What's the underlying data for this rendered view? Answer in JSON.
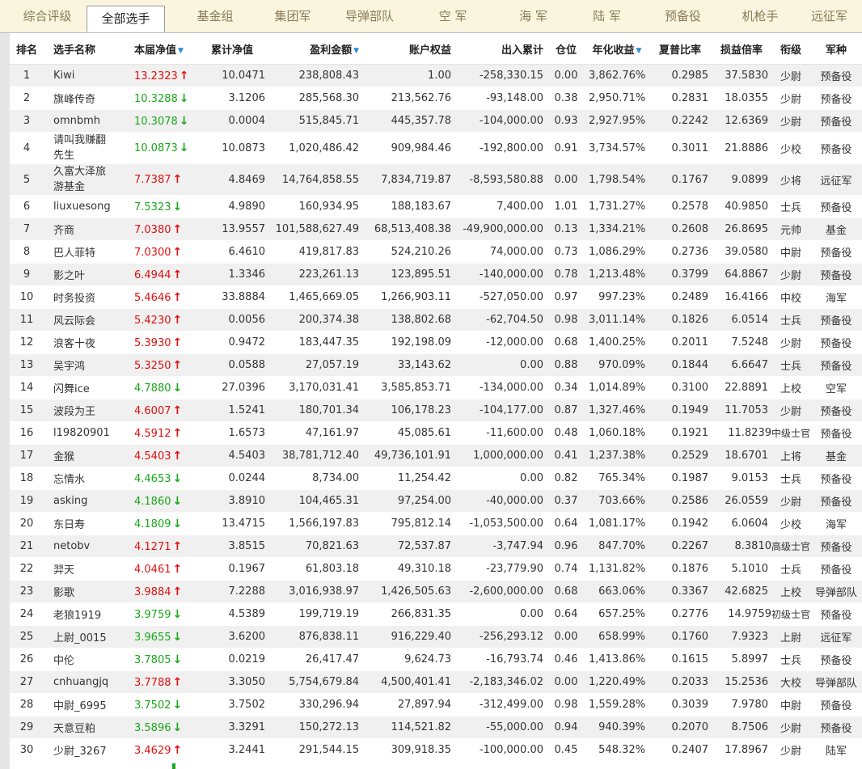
{
  "tabs": [
    "综合评级",
    "全部选手",
    "基金组",
    "集团军",
    "导弹部队",
    "空 军",
    "海 军",
    "陆 军",
    "预备役",
    "机枪手",
    "远征军"
  ],
  "active_tab": "全部选手",
  "columns": [
    "排名",
    "选手名称",
    "本届净值",
    "累计净值",
    "盈利金额",
    "账户权益",
    "出入累计",
    "仓位",
    "年化收益",
    "夏普比率",
    "损益倍率",
    "衔级",
    "军种"
  ],
  "sortable_icon": "sort-down-icon",
  "colors": {
    "up": "#e01010",
    "down": "#1aa81a",
    "accent": "#2a8fd0"
  },
  "rows": [
    {
      "rank": "1",
      "name": "Kiwi",
      "nv": "13.2323",
      "dir": "up",
      "cum": "10.0471",
      "profit": "238,808.43",
      "equity": "1.00",
      "flow": "-258,330.15",
      "pos": "0.00",
      "annual": "3,862.76%",
      "sharpe": "0.2985",
      "pl": "37.5830",
      "rankTitle": "少尉",
      "branch": "预备役"
    },
    {
      "rank": "2",
      "name": "旗峰传奇",
      "nv": "10.3288",
      "dir": "down",
      "cum": "3.1206",
      "profit": "285,568.30",
      "equity": "213,562.76",
      "flow": "-93,148.00",
      "pos": "0.38",
      "annual": "2,950.71%",
      "sharpe": "0.2831",
      "pl": "18.0355",
      "rankTitle": "少尉",
      "branch": "预备役"
    },
    {
      "rank": "3",
      "name": "omnbmh",
      "nv": "10.3078",
      "dir": "down",
      "cum": "0.0004",
      "profit": "515,845.71",
      "equity": "445,357.78",
      "flow": "-104,000.00",
      "pos": "0.93",
      "annual": "2,927.95%",
      "sharpe": "0.2242",
      "pl": "12.6369",
      "rankTitle": "少尉",
      "branch": "预备役"
    },
    {
      "rank": "4",
      "name": "请叫我赚翻先生",
      "nv": "10.0873",
      "dir": "down",
      "cum": "10.0873",
      "profit": "1,020,486.42",
      "equity": "909,984.46",
      "flow": "-192,800.00",
      "pos": "0.91",
      "annual": "3,734.57%",
      "sharpe": "0.3011",
      "pl": "21.8886",
      "rankTitle": "少校",
      "branch": "预备役",
      "tall": true
    },
    {
      "rank": "5",
      "name": "久富大泽旅游基金",
      "nv": "7.7387",
      "dir": "up",
      "cum": "4.8469",
      "profit": "14,764,858.55",
      "equity": "7,834,719.87",
      "flow": "-8,593,580.88",
      "pos": "0.00",
      "annual": "1,798.54%",
      "sharpe": "0.1767",
      "pl": "9.0899",
      "rankTitle": "少将",
      "branch": "远征军",
      "tall": true
    },
    {
      "rank": "6",
      "name": "liuxuesong",
      "nv": "7.5323",
      "dir": "down",
      "cum": "4.9890",
      "profit": "160,934.95",
      "equity": "188,183.67",
      "flow": "7,400.00",
      "pos": "1.01",
      "annual": "1,731.27%",
      "sharpe": "0.2578",
      "pl": "40.9850",
      "rankTitle": "士兵",
      "branch": "预备役"
    },
    {
      "rank": "7",
      "name": "齐商",
      "nv": "7.0380",
      "dir": "up",
      "cum": "13.9557",
      "profit": "101,588,627.49",
      "equity": "68,513,408.38",
      "flow": "-49,900,000.00",
      "pos": "0.13",
      "annual": "1,334.21%",
      "sharpe": "0.2608",
      "pl": "26.8695",
      "rankTitle": "元帅",
      "branch": "基金"
    },
    {
      "rank": "8",
      "name": "巴人菲特",
      "nv": "7.0300",
      "dir": "up",
      "cum": "6.4610",
      "profit": "419,817.83",
      "equity": "524,210.26",
      "flow": "74,000.00",
      "pos": "0.73",
      "annual": "1,086.29%",
      "sharpe": "0.2736",
      "pl": "39.0580",
      "rankTitle": "中尉",
      "branch": "预备役"
    },
    {
      "rank": "9",
      "name": "影之叶",
      "nv": "6.4944",
      "dir": "up",
      "cum": "1.3346",
      "profit": "223,261.13",
      "equity": "123,895.51",
      "flow": "-140,000.00",
      "pos": "0.78",
      "annual": "1,213.48%",
      "sharpe": "0.3799",
      "pl": "64.8867",
      "rankTitle": "少尉",
      "branch": "预备役"
    },
    {
      "rank": "10",
      "name": "时务投资",
      "nv": "5.4646",
      "dir": "up",
      "cum": "33.8884",
      "profit": "1,465,669.05",
      "equity": "1,266,903.11",
      "flow": "-527,050.00",
      "pos": "0.97",
      "annual": "997.23%",
      "sharpe": "0.2489",
      "pl": "16.4166",
      "rankTitle": "中校",
      "branch": "海军"
    },
    {
      "rank": "11",
      "name": "风云际会",
      "nv": "5.4230",
      "dir": "up",
      "cum": "0.0056",
      "profit": "200,374.38",
      "equity": "138,802.68",
      "flow": "-62,704.50",
      "pos": "0.98",
      "annual": "3,011.14%",
      "sharpe": "0.1826",
      "pl": "6.0514",
      "rankTitle": "士兵",
      "branch": "预备役"
    },
    {
      "rank": "12",
      "name": "浪客十夜",
      "nv": "5.3930",
      "dir": "up",
      "cum": "0.9472",
      "profit": "183,447.35",
      "equity": "192,198.09",
      "flow": "-12,000.00",
      "pos": "0.68",
      "annual": "1,400.25%",
      "sharpe": "0.2011",
      "pl": "7.5248",
      "rankTitle": "少尉",
      "branch": "预备役"
    },
    {
      "rank": "13",
      "name": "吴宇鸿",
      "nv": "5.3250",
      "dir": "up",
      "cum": "0.0588",
      "profit": "27,057.19",
      "equity": "33,143.62",
      "flow": "0.00",
      "pos": "0.88",
      "annual": "970.09%",
      "sharpe": "0.1844",
      "pl": "6.6647",
      "rankTitle": "士兵",
      "branch": "预备役"
    },
    {
      "rank": "14",
      "name": "闪舞ice",
      "nv": "4.7880",
      "dir": "down",
      "cum": "27.0396",
      "profit": "3,170,031.41",
      "equity": "3,585,853.71",
      "flow": "-134,000.00",
      "pos": "0.34",
      "annual": "1,014.89%",
      "sharpe": "0.3100",
      "pl": "22.8891",
      "rankTitle": "上校",
      "branch": "空军"
    },
    {
      "rank": "15",
      "name": "波段为王",
      "nv": "4.6007",
      "dir": "up",
      "cum": "1.5241",
      "profit": "180,701.34",
      "equity": "106,178.23",
      "flow": "-104,177.00",
      "pos": "0.87",
      "annual": "1,327.46%",
      "sharpe": "0.1949",
      "pl": "11.7053",
      "rankTitle": "少尉",
      "branch": "预备役"
    },
    {
      "rank": "16",
      "name": "l19820901",
      "nv": "4.5912",
      "dir": "up",
      "cum": "1.6573",
      "profit": "47,161.97",
      "equity": "45,085.61",
      "flow": "-11,600.00",
      "pos": "0.48",
      "annual": "1,060.18%",
      "sharpe": "0.1921",
      "pl": "11.8239",
      "rankTitle": "中级士官",
      "branch": "预备役"
    },
    {
      "rank": "17",
      "name": "金猴",
      "nv": "4.5403",
      "dir": "up",
      "cum": "4.5403",
      "profit": "38,781,712.40",
      "equity": "49,736,101.91",
      "flow": "1,000,000.00",
      "pos": "0.41",
      "annual": "1,237.38%",
      "sharpe": "0.2529",
      "pl": "18.6701",
      "rankTitle": "上将",
      "branch": "基金"
    },
    {
      "rank": "18",
      "name": "忘情水",
      "nv": "4.4653",
      "dir": "down",
      "cum": "0.0244",
      "profit": "8,734.00",
      "equity": "11,254.42",
      "flow": "0.00",
      "pos": "0.82",
      "annual": "765.34%",
      "sharpe": "0.1987",
      "pl": "9.0153",
      "rankTitle": "士兵",
      "branch": "预备役"
    },
    {
      "rank": "19",
      "name": "asking",
      "nv": "4.1860",
      "dir": "down",
      "cum": "3.8910",
      "profit": "104,465.31",
      "equity": "97,254.00",
      "flow": "-40,000.00",
      "pos": "0.37",
      "annual": "703.66%",
      "sharpe": "0.2586",
      "pl": "26.0559",
      "rankTitle": "少尉",
      "branch": "预备役"
    },
    {
      "rank": "20",
      "name": "东日寿",
      "nv": "4.1809",
      "dir": "down",
      "cum": "13.4715",
      "profit": "1,566,197.83",
      "equity": "795,812.14",
      "flow": "-1,053,500.00",
      "pos": "0.64",
      "annual": "1,081.17%",
      "sharpe": "0.1942",
      "pl": "6.0604",
      "rankTitle": "少校",
      "branch": "海军"
    },
    {
      "rank": "21",
      "name": "netobv",
      "nv": "4.1271",
      "dir": "up",
      "cum": "3.8515",
      "profit": "70,821.63",
      "equity": "72,537.87",
      "flow": "-3,747.94",
      "pos": "0.96",
      "annual": "847.70%",
      "sharpe": "0.2267",
      "pl": "8.3810",
      "rankTitle": "高级士官",
      "branch": "预备役"
    },
    {
      "rank": "22",
      "name": "羿天",
      "nv": "4.0461",
      "dir": "up",
      "cum": "0.1967",
      "profit": "61,803.18",
      "equity": "49,310.18",
      "flow": "-23,779.90",
      "pos": "0.74",
      "annual": "1,131.82%",
      "sharpe": "0.1876",
      "pl": "5.1010",
      "rankTitle": "士兵",
      "branch": "预备役"
    },
    {
      "rank": "23",
      "name": "影歌",
      "nv": "3.9884",
      "dir": "up",
      "cum": "7.2288",
      "profit": "3,016,938.97",
      "equity": "1,426,505.63",
      "flow": "-2,600,000.00",
      "pos": "0.68",
      "annual": "663.06%",
      "sharpe": "0.3367",
      "pl": "42.6825",
      "rankTitle": "上校",
      "branch": "导弹部队"
    },
    {
      "rank": "24",
      "name": "老狼1919",
      "nv": "3.9759",
      "dir": "down",
      "cum": "4.5389",
      "profit": "199,719.19",
      "equity": "266,831.35",
      "flow": "0.00",
      "pos": "0.64",
      "annual": "657.25%",
      "sharpe": "0.2776",
      "pl": "14.9759",
      "rankTitle": "初级士官",
      "branch": "预备役"
    },
    {
      "rank": "25",
      "name": "上尉_0015",
      "nv": "3.9655",
      "dir": "down",
      "cum": "3.6200",
      "profit": "876,838.11",
      "equity": "916,229.40",
      "flow": "-256,293.12",
      "pos": "0.00",
      "annual": "658.99%",
      "sharpe": "0.1760",
      "pl": "7.9323",
      "rankTitle": "上尉",
      "branch": "远征军"
    },
    {
      "rank": "26",
      "name": "中伦",
      "nv": "3.7805",
      "dir": "down",
      "cum": "0.0219",
      "profit": "26,417.47",
      "equity": "9,624.73",
      "flow": "-16,793.74",
      "pos": "0.46",
      "annual": "1,413.86%",
      "sharpe": "0.1615",
      "pl": "5.8997",
      "rankTitle": "士兵",
      "branch": "预备役"
    },
    {
      "rank": "27",
      "name": "cnhuangjq",
      "nv": "3.7788",
      "dir": "up",
      "cum": "3.3050",
      "profit": "5,754,679.84",
      "equity": "4,500,401.41",
      "flow": "-2,183,346.02",
      "pos": "0.00",
      "annual": "1,220.49%",
      "sharpe": "0.2033",
      "pl": "15.2536",
      "rankTitle": "大校",
      "branch": "导弹部队"
    },
    {
      "rank": "28",
      "name": "中尉_6995",
      "nv": "3.7502",
      "dir": "down",
      "cum": "3.7502",
      "profit": "330,296.94",
      "equity": "27,897.94",
      "flow": "-312,499.00",
      "pos": "0.98",
      "annual": "1,559.28%",
      "sharpe": "0.3039",
      "pl": "7.9780",
      "rankTitle": "中尉",
      "branch": "预备役"
    },
    {
      "rank": "29",
      "name": "天意豆粕",
      "nv": "3.5896",
      "dir": "down",
      "cum": "3.3291",
      "profit": "150,272.13",
      "equity": "114,521.82",
      "flow": "-55,000.00",
      "pos": "0.94",
      "annual": "940.39%",
      "sharpe": "0.2070",
      "pl": "8.7506",
      "rankTitle": "少尉",
      "branch": "预备役"
    },
    {
      "rank": "30",
      "name": "少尉_3267",
      "nv": "3.4629",
      "dir": "up",
      "cum": "3.2441",
      "profit": "291,544.15",
      "equity": "309,918.35",
      "flow": "-100,000.00",
      "pos": "0.45",
      "annual": "548.32%",
      "sharpe": "0.2407",
      "pl": "17.8967",
      "rankTitle": "少尉",
      "branch": "陆军"
    }
  ],
  "partial_next_row_dir": "down"
}
